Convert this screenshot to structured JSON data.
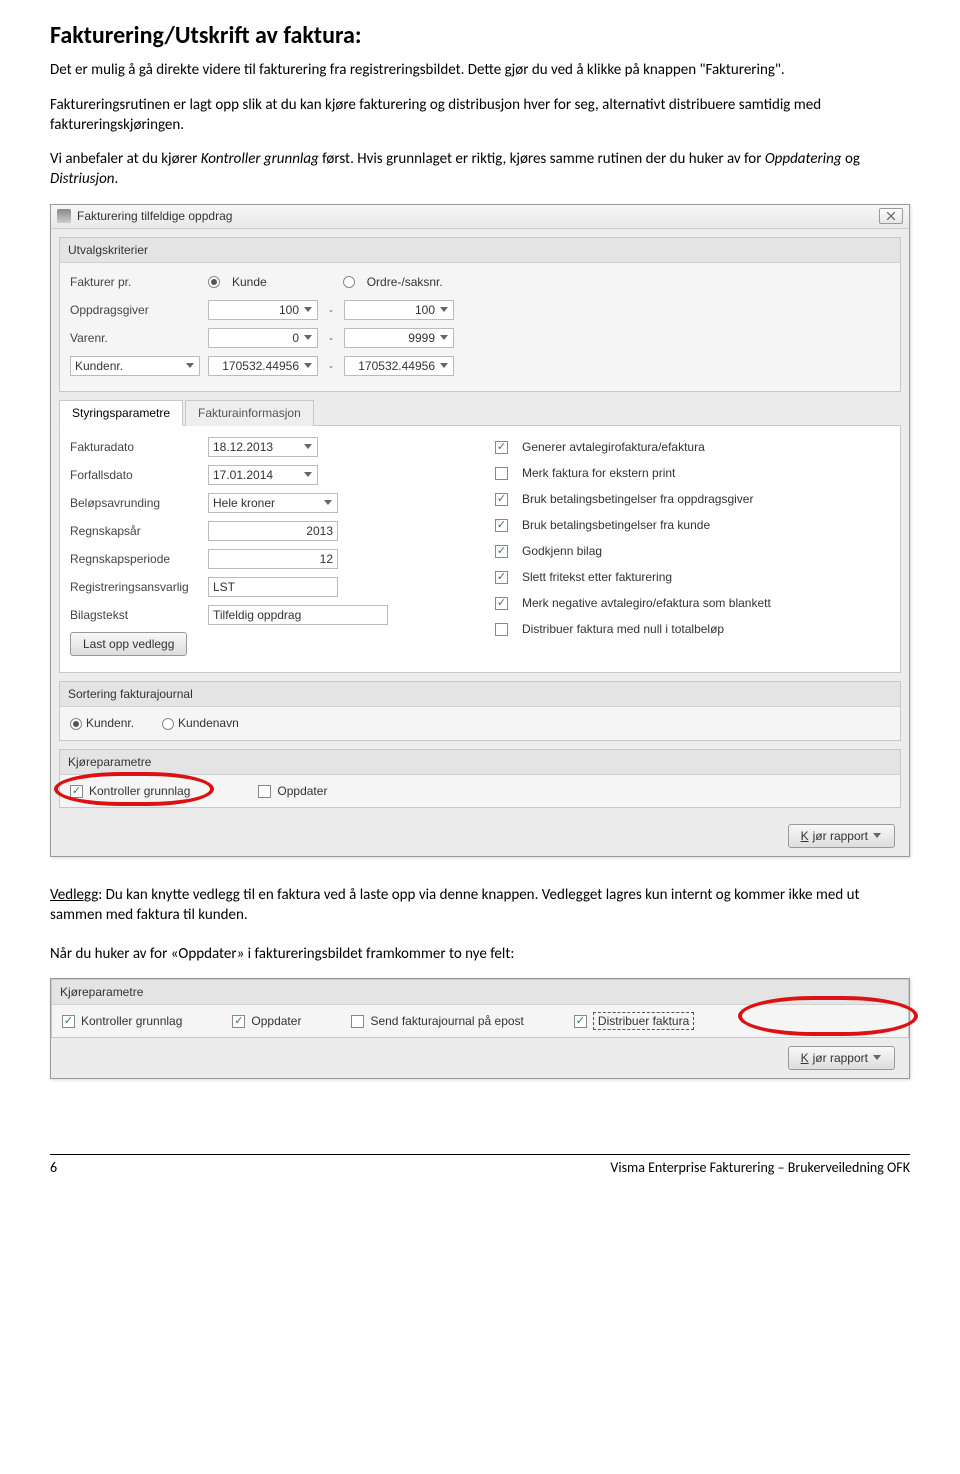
{
  "heading": "Fakturering/Utskrift av faktura:",
  "intro1": "Det er mulig å gå direkte videre til fakturering fra registreringsbildet. Dette gjør du ved å klikke på knappen \"Fakturering\".",
  "intro2": "Faktureringsrutinen er lagt opp slik at du kan kjøre fakturering og distribusjon hver for seg, alternativt distribuere samtidig med faktureringskjøringen.",
  "intro3a": "Vi anbefaler at du kjører ",
  "intro3b": "Kontroller grunnlag",
  "intro3c": " først. Hvis grunnlaget er riktig, kjøres samme rutinen der du huker av for ",
  "intro3d": "Oppdatering",
  "intro3e": " og ",
  "intro3f": "Distriusjon",
  "intro3g": ".",
  "dialog": {
    "title": "Fakturering tilfeldige oppdrag",
    "group_utv": "Utvalgskriterier",
    "fakturerpr": "Fakturer pr.",
    "kunde": "Kunde",
    "ordresak": "Ordre-/saksnr.",
    "oppdragsgiver": "Oppdragsgiver",
    "og_from": "100",
    "og_to": "100",
    "varenr": "Varenr.",
    "vn_from": "0",
    "vn_to": "9999",
    "kundenr_drop": "Kundenr.",
    "kn_from": "170532.44956",
    "kn_to": "170532.44956",
    "tab1": "Styringsparametre",
    "tab2": "Fakturainformasjon",
    "fakturadato": "Fakturadato",
    "fakturadato_v": "18.12.2013",
    "forfallsdato": "Forfallsdato",
    "forfallsdato_v": "17.01.2014",
    "belopsavrunding": "Beløpsavrunding",
    "belopsavrunding_v": "Hele kroner",
    "regnskapsar": "Regnskapsår",
    "regnskapsar_v": "2013",
    "regnskapsperiode": "Regnskapsperiode",
    "regnskapsperiode_v": "12",
    "reg_ansvarlig": "Registreringsansvarlig",
    "reg_ansvarlig_v": "LST",
    "bilagstekst": "Bilagstekst",
    "bilagstekst_v": "Tilfeldig oppdrag",
    "last_opp": "Last opp vedlegg",
    "cb1": "Generer avtalegirofaktura/efaktura",
    "cb2": "Merk faktura for ekstern print",
    "cb3": "Bruk betalingsbetingelser fra oppdragsgiver",
    "cb4": "Bruk betalingsbetingelser fra kunde",
    "cb5": "Godkjenn bilag",
    "cb6": "Slett fritekst etter fakturering",
    "cb7": "Merk negative avtalegiro/efaktura som blankett",
    "cb8": "Distribuer faktura med null i totalbeløp",
    "sort_header": "Sortering fakturajournal",
    "sort_kundenr": "Kundenr.",
    "sort_kundenavn": "Kundenavn",
    "kjore_header": "Kjøreparametre",
    "kontroller_grunnlag": "Kontroller grunnlag",
    "oppdater": "Oppdater",
    "kjor_rapport": "Kjør rapport"
  },
  "vedlegg_label": "Vedlegg",
  "vedlegg_text": ":  Du kan knytte vedlegg til en faktura ved å laste opp via denne knappen. Vedlegget lagres kun internt og kommer ikke med ut sammen med faktura til kunden.",
  "oppdater_text": "Når du huker av for «Oppdater» i faktureringsbildet framkommer to nye felt:",
  "dialog2": {
    "kjore_header": "Kjøreparametre",
    "kontroller_grunnlag": "Kontroller grunnlag",
    "oppdater": "Oppdater",
    "send_epost": "Send fakturajournal på epost",
    "distribuer": "Distribuer faktura",
    "kjor_rapport": "Kjør rapport"
  },
  "footer_page": "6",
  "footer_doc": "Visma Enterprise Fakturering – Brukerveiledning OFK"
}
